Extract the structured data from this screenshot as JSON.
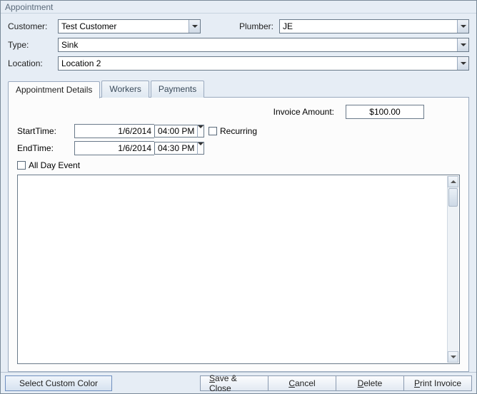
{
  "window": {
    "title": "Appointment"
  },
  "header": {
    "customer_label": "Customer:",
    "customer_value": "Test Customer",
    "plumber_label": "Plumber:",
    "plumber_value": "JE",
    "type_label": "Type:",
    "type_value": "Sink",
    "location_label": "Location:",
    "location_value": "Location 2"
  },
  "tabs": {
    "details": "Appointment Details",
    "workers": "Workers",
    "payments": "Payments"
  },
  "details": {
    "invoice_label": "Invoice Amount:",
    "invoice_value": "$100.00",
    "start_label": "StartTime:",
    "start_date": "1/6/2014",
    "start_time": "04:00 PM",
    "end_label": "EndTime:",
    "end_date": "1/6/2014",
    "end_time": "04:30 PM",
    "recurring_label": "Recurring",
    "allday_label": "All Day Event"
  },
  "footer": {
    "select_color": "Select Custom Color",
    "save_close": "Save & Close",
    "cancel": "Cancel",
    "delete": "Delete",
    "print_invoice": "Print Invoice"
  }
}
